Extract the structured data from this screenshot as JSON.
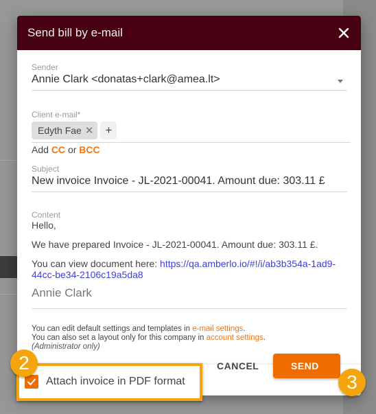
{
  "dialog": {
    "title": "Send bill by e-mail",
    "close_icon": "close-icon"
  },
  "sender": {
    "label": "Sender",
    "value": "Annie Clark <donatas+clark@amea.lt>"
  },
  "client_email": {
    "label": "Client e-mail*",
    "chips": [
      {
        "label": "Edyth Fae"
      }
    ],
    "add_label": "+",
    "cc_prefix": "Add",
    "cc_label": "CC",
    "cc_or": "or",
    "bcc_label": "BCC"
  },
  "subject": {
    "label": "Subject",
    "value": "New invoice Invoice - JL-2021-00041. Amount due: 303.11 £"
  },
  "content": {
    "label": "Content",
    "greeting": "Hello,",
    "body_line": "We have prepared Invoice - JL-2021-00041. Amount due: 303.11 £.",
    "view_prefix": "You can view document here: ",
    "view_link": "https://qa.amberlo.io/#!/i/ab3b354a-1ad9-44cc-be34-2106c19a5da8",
    "signature": "Annie Clark"
  },
  "hint": {
    "line1_prefix": "You can edit default settings and templates in ",
    "line1_link": "e-mail settings",
    "line1_suffix": ".",
    "line2_prefix": "You can also set a layout only for this company in ",
    "line2_link": "account settings",
    "line2_suffix": ".",
    "line3": "(Administrator only)"
  },
  "footer": {
    "attach_label": "Attach invoice in PDF format",
    "attach_checked": true,
    "cancel_label": "CANCEL",
    "send_label": "SEND"
  },
  "annotations": {
    "step_2": "2",
    "step_3": "3",
    "highlight_color": "#f5a50c"
  },
  "colors": {
    "header_bg": "#460011",
    "accent": "#ef6c00",
    "link": "#3d3fd8"
  }
}
